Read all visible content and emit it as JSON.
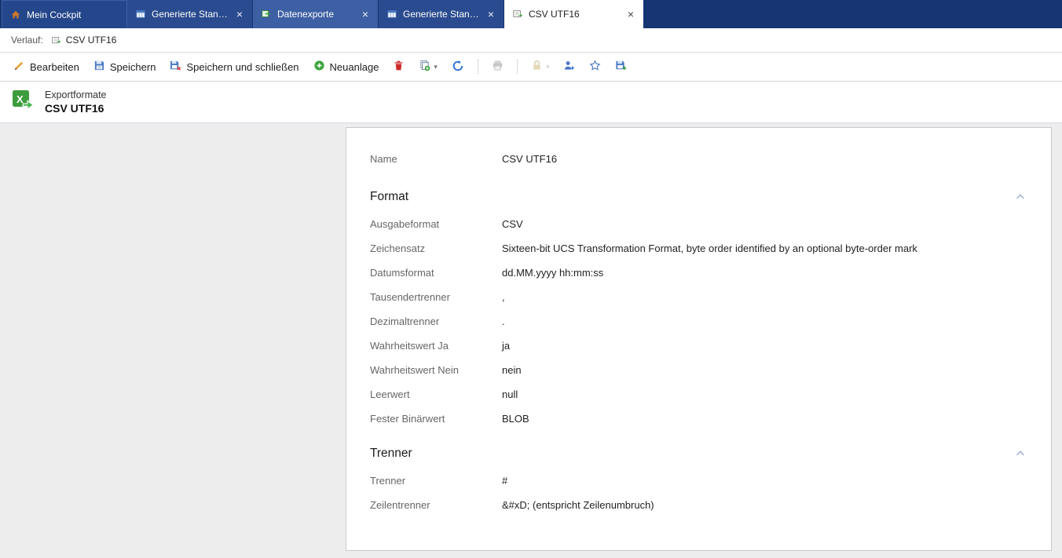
{
  "ui": {
    "close_glyph": "×"
  },
  "tabs": [
    {
      "label": "Mein Cockpit",
      "icon": "home-icon",
      "active": false,
      "closable": false
    },
    {
      "label": "Generierte Standar...",
      "icon": "report-icon",
      "active": false,
      "closable": true
    },
    {
      "label": "Datenexporte",
      "icon": "export-icon",
      "active": false,
      "closable": true
    },
    {
      "label": "Generierte Standar...",
      "icon": "report-icon",
      "active": false,
      "closable": true
    },
    {
      "label": "CSV UTF16",
      "icon": "csv-icon",
      "active": true,
      "closable": true
    }
  ],
  "breadcrumb": {
    "label": "Verlauf:",
    "item": "CSV UTF16"
  },
  "toolbar": {
    "bearbeiten": "Bearbeiten",
    "speichern": "Speichern",
    "speichern_schliessen": "Speichern und schließen",
    "neuanlage": "Neuanlage"
  },
  "header": {
    "app": "Exportformate",
    "title": "CSV UTF16"
  },
  "form": {
    "name": {
      "label": "Name",
      "value": "CSV UTF16"
    },
    "sections": [
      {
        "title": "Format",
        "fields": [
          {
            "label": "Ausgabeformat",
            "value": "CSV"
          },
          {
            "label": "Zeichensatz",
            "value": "Sixteen-bit UCS Transformation Format, byte order identified by an optional byte-order mark"
          },
          {
            "label": "Datumsformat",
            "value": "dd.MM.yyyy hh:mm:ss"
          },
          {
            "label": "Tausendertrenner",
            "value": ","
          },
          {
            "label": "Dezimaltrenner",
            "value": "."
          },
          {
            "label": "Wahrheitswert Ja",
            "value": "ja"
          },
          {
            "label": "Wahrheitswert Nein",
            "value": "nein"
          },
          {
            "label": "Leerwert",
            "value": "null"
          },
          {
            "label": "Fester Binärwert",
            "value": "BLOB"
          }
        ]
      },
      {
        "title": "Trenner",
        "fields": [
          {
            "label": "Trenner",
            "value": "#"
          },
          {
            "label": "Zeilentrenner",
            "value": "&#xD; (entspricht Zeilenumbruch)"
          }
        ]
      }
    ]
  },
  "icons": {
    "edit": "pencil-icon",
    "save": "floppy-icon",
    "save_close": "floppy-close-icon",
    "new": "plus-circle-icon",
    "delete": "trash-icon",
    "copy": "copy-icon",
    "refresh": "refresh-icon",
    "print": "printer-icon",
    "lock": "lock-icon",
    "user_add": "user-plus-icon",
    "favorite": "star-icon",
    "save_extra": "floppy-plus-icon",
    "section_collapse": "chevron-up-icon"
  },
  "colors": {
    "tabbar_bg": "#173572",
    "tab_inactive": "#2a4b8f",
    "tab_active_bg": "#ffffff",
    "accent_blue": "#2f6fd6",
    "accent_green": "#3aa43a",
    "danger_red": "#cc2a2a",
    "edit_orange": "#e8a23c",
    "content_bg": "#ededed",
    "panel_border": "#c9c9c9"
  }
}
